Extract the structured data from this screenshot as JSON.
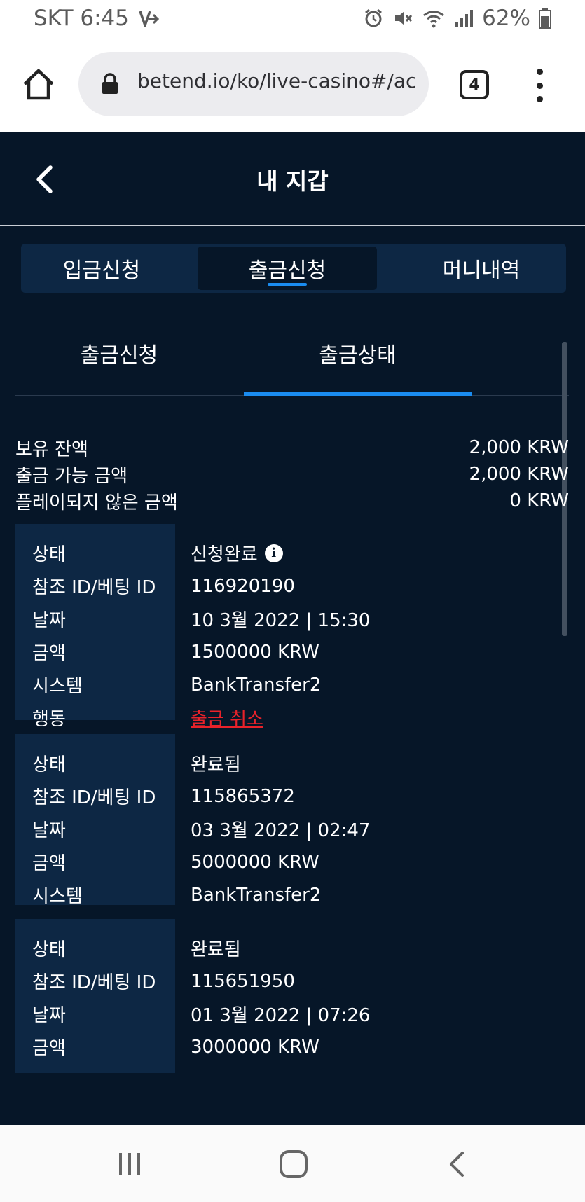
{
  "status_bar": {
    "carrier_time": "SKT 6:45",
    "battery": "62%"
  },
  "browser": {
    "url": "betend.io/ko/live-casino#/acc",
    "tab_count": "4"
  },
  "header": {
    "title": "내 지갑"
  },
  "main_tabs": [
    {
      "label": "입금신청",
      "active": false
    },
    {
      "label": "출금신청",
      "active": true
    },
    {
      "label": "머니내역",
      "active": false
    }
  ],
  "sub_tabs": [
    {
      "label": "출금신청",
      "active": false
    },
    {
      "label": "출금상태",
      "active": true
    }
  ],
  "summary": [
    {
      "label": "보유 잔액",
      "value": "2,000 KRW"
    },
    {
      "label": "출금 가능 금액",
      "value": "2,000 KRW"
    },
    {
      "label": "플레이되지 않은 금액",
      "value": "0 KRW"
    }
  ],
  "transactions": [
    {
      "status_label": "상태",
      "status": "신청완료",
      "ref_label": "참조 ID/베팅 ID",
      "ref": "116920190",
      "date_label": "날짜",
      "date": "10 3월 2022 | 15:30",
      "amount_label": "금액",
      "amount": "1500000 KRW",
      "system_label": "시스템",
      "system": "BankTransfer2",
      "action_label": "행동",
      "action": "출금 취소"
    },
    {
      "status_label": "상태",
      "status": "완료됨",
      "ref_label": "참조 ID/베팅 ID",
      "ref": "115865372",
      "date_label": "날짜",
      "date": "03 3월 2022 | 02:47",
      "amount_label": "금액",
      "amount": "5000000 KRW",
      "system_label": "시스템",
      "system": "BankTransfer2"
    },
    {
      "status_label": "상태",
      "status": "완료됨",
      "ref_label": "참조 ID/베팅 ID",
      "ref": "115651950",
      "date_label": "날짜",
      "date": "01 3월 2022 | 07:26",
      "amount_label": "금액",
      "amount": "3000000 KRW"
    }
  ],
  "colors": {
    "app_background": "#061628",
    "panel": "#0d2744",
    "accent_blue": "#1a8cf0",
    "cancel_red": "#e8222a"
  }
}
